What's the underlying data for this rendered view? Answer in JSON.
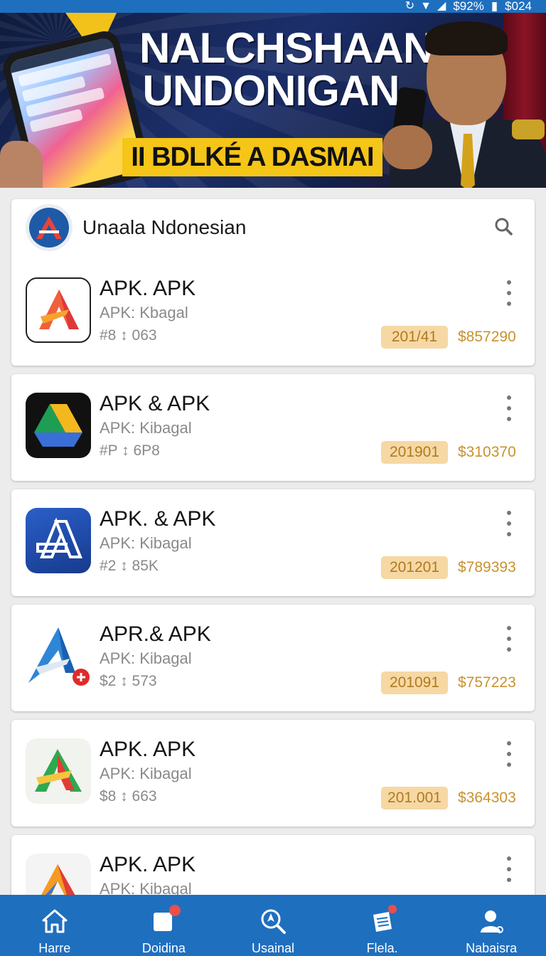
{
  "status_bar": {
    "battery_text": "$92%",
    "time_text": "$024",
    "icons": [
      "sync-icon",
      "wifi-icon",
      "signal-icon",
      "battery-icon"
    ]
  },
  "banner": {
    "title_line1": "NALCHSHAAN",
    "title_line2": "UNDONIGAN",
    "subtitle": "II BDLKÉ A DASMAI"
  },
  "header": {
    "brand_name": "Unaala Ndonesian",
    "search_icon": "search-icon"
  },
  "apps": [
    {
      "title": "APK. APK",
      "subtitle": "APK: Kbagal",
      "meta": "#8 ↕ 063",
      "badge": "201/41",
      "price": "$857290",
      "icon": "apk-red-orange"
    },
    {
      "title": "APK & APK",
      "subtitle": "APK: Kibagal",
      "meta": "#P ↕ 6P8",
      "badge": "201901",
      "price": "$310370",
      "icon": "apk-drive-style"
    },
    {
      "title": "APK. & APK",
      "subtitle": "APK: Kibagal",
      "meta": "#2 ↕ 85K",
      "badge": "201201",
      "price": "$789393",
      "icon": "apk-blue-outline"
    },
    {
      "title": "APR.& APK",
      "subtitle": "APK: Kibagal",
      "meta": "$2 ↕ 573",
      "badge": "201091",
      "price": "$757223",
      "icon": "apk-blue-fold"
    },
    {
      "title": "APK. APK",
      "subtitle": "APK: Kibagal",
      "meta": "$8 ↕ 663",
      "badge": "201.001",
      "price": "$364303",
      "icon": "apk-green-red"
    },
    {
      "title": "APK. APK",
      "subtitle": "APK: Kibagal",
      "icon": "apk-orange-red"
    }
  ],
  "nav": [
    {
      "label": "Harre",
      "icon": "home-icon"
    },
    {
      "label": "Doidina",
      "icon": "doc-icon"
    },
    {
      "label": "Usainal",
      "icon": "search-compass-icon"
    },
    {
      "label": "Flela.",
      "icon": "files-icon"
    },
    {
      "label": "Nabaisra",
      "icon": "profile-icon"
    }
  ],
  "colors": {
    "primary": "#1f6fbf",
    "badge_bg": "#f6d8a4",
    "badge_text": "#b07a1e",
    "price": "#c8922e",
    "notification": "#e8504a",
    "subtitle_yellow": "#f5c518"
  }
}
